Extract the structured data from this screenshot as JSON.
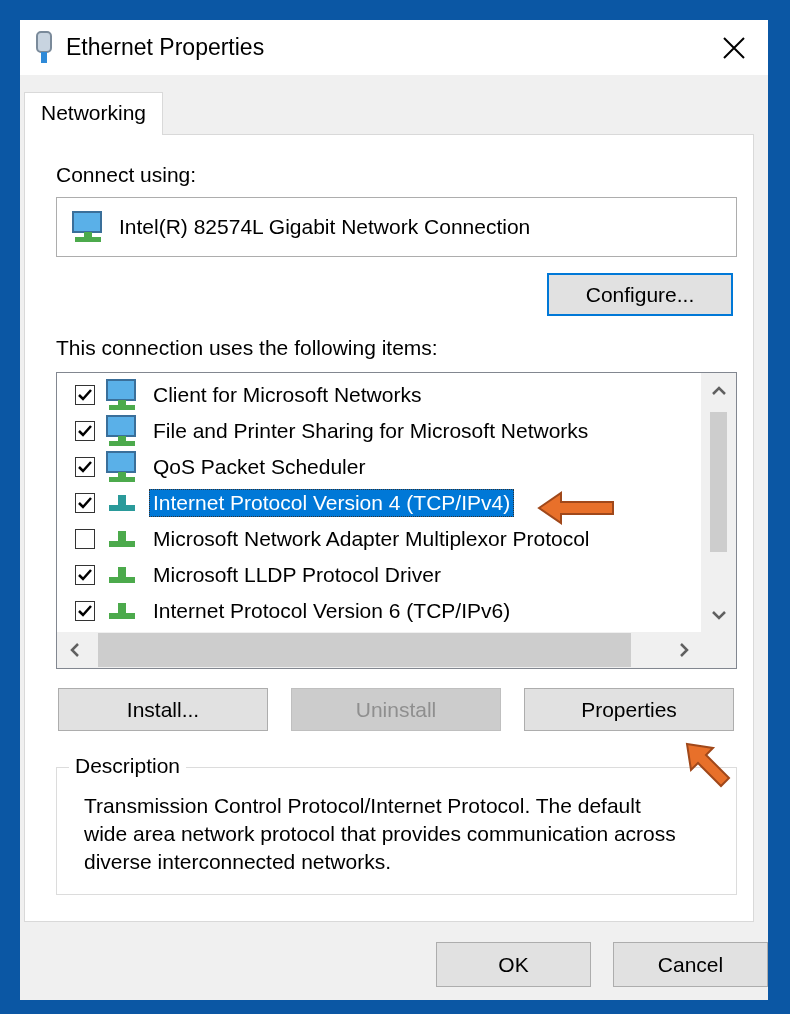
{
  "window": {
    "title": "Ethernet Properties"
  },
  "tabs": [
    {
      "label": "Networking",
      "selected": true
    }
  ],
  "connect_using": {
    "label": "Connect using:",
    "adapter": "Intel(R) 82574L Gigabit Network Connection"
  },
  "configure_button": "Configure...",
  "items_label": "This connection uses the following items:",
  "items": [
    {
      "name": "Client for Microsoft Networks",
      "checked": true,
      "selected": false,
      "kind": "client"
    },
    {
      "name": "File and Printer Sharing for Microsoft Networks",
      "checked": true,
      "selected": false,
      "kind": "service"
    },
    {
      "name": "QoS Packet Scheduler",
      "checked": true,
      "selected": false,
      "kind": "service"
    },
    {
      "name": "Internet Protocol Version 4 (TCP/IPv4)",
      "checked": true,
      "selected": true,
      "kind": "protocol"
    },
    {
      "name": "Microsoft Network Adapter Multiplexor Protocol",
      "checked": false,
      "selected": false,
      "kind": "protocol"
    },
    {
      "name": "Microsoft LLDP Protocol Driver",
      "checked": true,
      "selected": false,
      "kind": "protocol"
    },
    {
      "name": "Internet Protocol Version 6 (TCP/IPv6)",
      "checked": true,
      "selected": false,
      "kind": "protocol"
    }
  ],
  "item_buttons": [
    {
      "label": "Install...",
      "disabled": false
    },
    {
      "label": "Uninstall",
      "disabled": true
    },
    {
      "label": "Properties",
      "disabled": false
    }
  ],
  "description": {
    "title": "Description",
    "text": "Transmission Control Protocol/Internet Protocol. The default wide area network protocol that provides communication across diverse interconnected networks."
  },
  "dialog_buttons": [
    "OK",
    "Cancel"
  ]
}
